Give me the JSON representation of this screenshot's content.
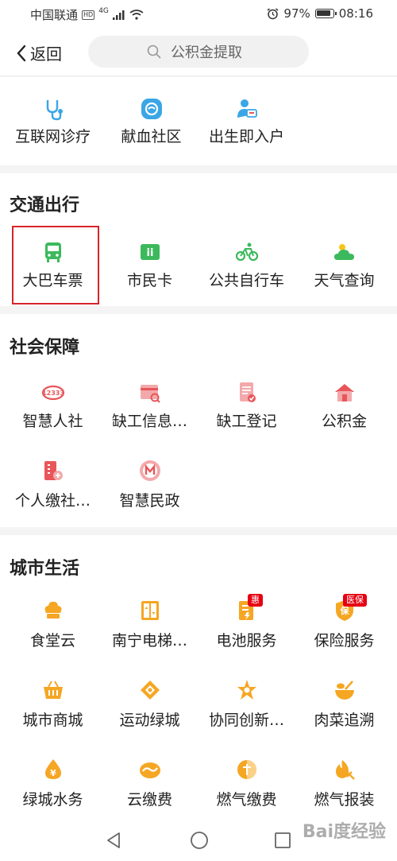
{
  "status_bar": {
    "carrier": "中国联通",
    "network_badge": "HD",
    "signal_type": "4G",
    "battery_percent": "97%",
    "time": "08:16"
  },
  "header": {
    "back_label": "返回",
    "search_placeholder": "公积金提取"
  },
  "health": {
    "items": [
      {
        "label": "互联网诊疗",
        "icon": "stethoscope-icon"
      },
      {
        "label": "献血社区",
        "icon": "blood-donation-icon"
      },
      {
        "label": "出生即入户",
        "icon": "newborn-icon"
      }
    ]
  },
  "transport": {
    "title": "交通出行",
    "items": [
      {
        "label": "大巴车票",
        "icon": "bus-icon"
      },
      {
        "label": "市民卡",
        "icon": "citizen-card-icon"
      },
      {
        "label": "公共自行车",
        "icon": "bicycle-icon"
      },
      {
        "label": "天气查询",
        "icon": "weather-icon"
      }
    ]
  },
  "social": {
    "title": "社会保障",
    "items": [
      {
        "label": "智慧人社",
        "icon": "smart-hr-icon"
      },
      {
        "label": "缺工信息…",
        "icon": "job-info-icon"
      },
      {
        "label": "缺工登记",
        "icon": "job-register-icon"
      },
      {
        "label": "公积金",
        "icon": "housing-fund-icon"
      },
      {
        "label": "个人缴社…",
        "icon": "personal-insurance-icon"
      },
      {
        "label": "智慧民政",
        "icon": "civil-affairs-icon"
      }
    ]
  },
  "city": {
    "title": "城市生活",
    "items": [
      {
        "label": "食堂云",
        "icon": "canteen-icon"
      },
      {
        "label": "南宁电梯…",
        "icon": "elevator-icon"
      },
      {
        "label": "电池服务",
        "icon": "battery-service-icon",
        "badge": "惠"
      },
      {
        "label": "保险服务",
        "icon": "insurance-icon",
        "badge": "医保"
      },
      {
        "label": "城市商城",
        "icon": "shopping-basket-icon"
      },
      {
        "label": "运动绿城",
        "icon": "sports-icon"
      },
      {
        "label": "协同创新…",
        "icon": "innovation-icon"
      },
      {
        "label": "肉菜追溯",
        "icon": "food-trace-icon"
      },
      {
        "label": "绿城水务",
        "icon": "water-icon"
      },
      {
        "label": "云缴费",
        "icon": "cloud-payment-icon"
      },
      {
        "label": "燃气缴费",
        "icon": "gas-payment-icon"
      },
      {
        "label": "燃气报装",
        "icon": "gas-install-icon"
      }
    ]
  },
  "watermark": "Bai度经验",
  "colors": {
    "accent_green": "#3cb95c",
    "accent_red": "#e8565a",
    "accent_orange": "#f5a623",
    "highlight": "#d9232a"
  }
}
